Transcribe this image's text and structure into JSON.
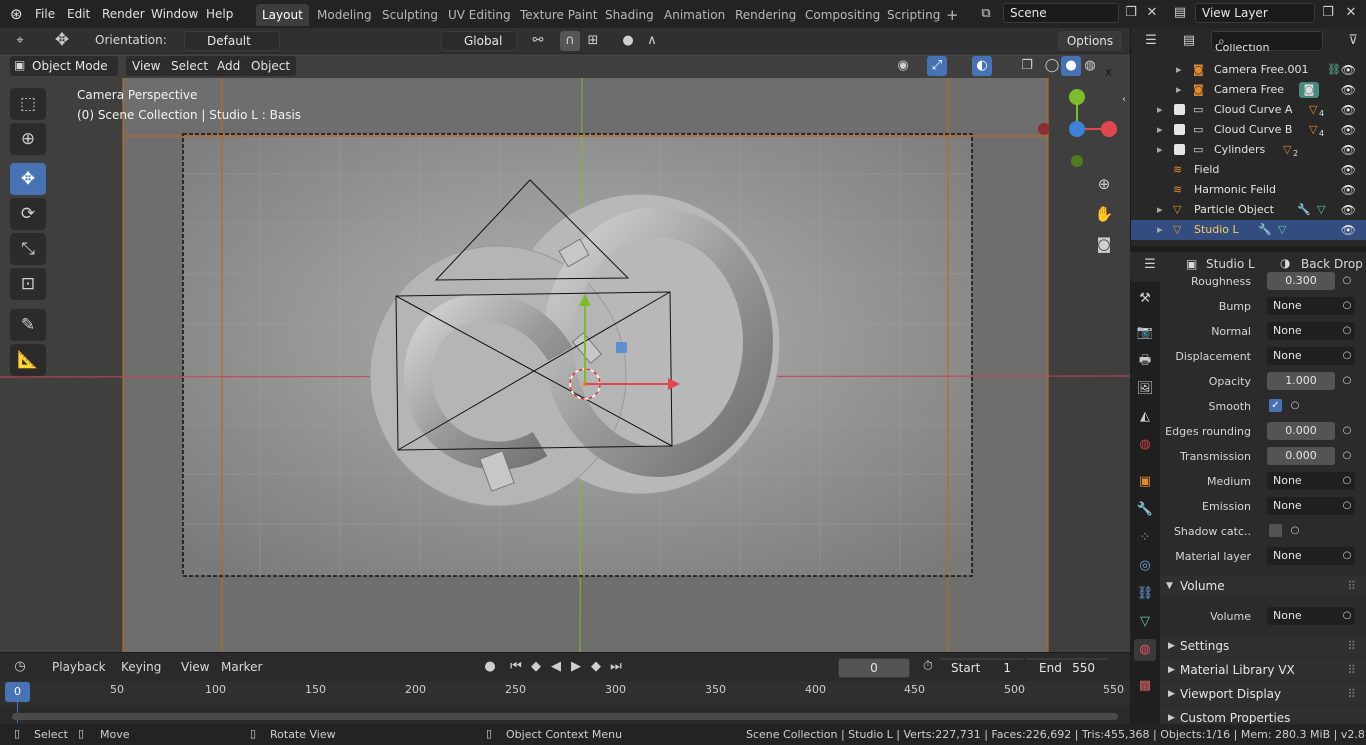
{
  "menu": [
    "File",
    "Edit",
    "Render",
    "Window",
    "Help"
  ],
  "workspaces": [
    "Layout",
    "Modeling",
    "Sculpting",
    "UV Editing",
    "Texture Paint",
    "Shading",
    "Animation",
    "Rendering",
    "Compositing",
    "Scripting"
  ],
  "active_workspace": "Layout",
  "add_workspace": "+",
  "scene": "Scene",
  "view_layer": "View Layer",
  "toolsettings": {
    "orientation_label": "Orientation:",
    "orientation_value": "Default",
    "transform_orientation": "Global",
    "options": "Options"
  },
  "viewport_header": {
    "mode": "Object Mode",
    "menus": [
      "View",
      "Select",
      "Add",
      "Object"
    ]
  },
  "viewport": {
    "line1": "Camera Perspective",
    "line2": "(0) Scene Collection | Studio L : Basis"
  },
  "gizmo_axes": {
    "y": "Y",
    "z": "Z",
    "x": "X"
  },
  "outliner": {
    "search_placeholder": "",
    "rows": [
      {
        "name": "Collection",
        "type": "collection"
      },
      {
        "name": "Camera Free.001",
        "type": "camera"
      },
      {
        "name": "Camera Free",
        "type": "camera"
      },
      {
        "name": "Cloud Curve A",
        "type": "collection",
        "badge": "4"
      },
      {
        "name": "Cloud Curve B",
        "type": "collection",
        "badge": "4"
      },
      {
        "name": "Cylinders",
        "type": "collection",
        "badge": "2"
      },
      {
        "name": "Field",
        "type": "force"
      },
      {
        "name": "Harmonic Feild",
        "type": "force"
      },
      {
        "name": "Particle Object",
        "type": "mesh"
      },
      {
        "name": "Studio L",
        "type": "mesh",
        "selected": true
      }
    ]
  },
  "properties": {
    "object": "Studio L",
    "material": "Back Drop",
    "rows": [
      {
        "label": "Roughness",
        "value": "0.300",
        "kind": "num"
      },
      {
        "label": "Bump",
        "value": "None",
        "kind": "none"
      },
      {
        "label": "Normal",
        "value": "None",
        "kind": "none"
      },
      {
        "label": "Displacement",
        "value": "None",
        "kind": "none"
      },
      {
        "label": "Opacity",
        "value": "1.000",
        "kind": "num"
      },
      {
        "label": "Smooth",
        "value": "",
        "kind": "check_on"
      },
      {
        "label": "Edges rounding",
        "value": "0.000",
        "kind": "num"
      },
      {
        "label": "Transmission",
        "value": "0.000",
        "kind": "num"
      },
      {
        "label": "Medium",
        "value": "None",
        "kind": "none"
      },
      {
        "label": "Emission",
        "value": "None",
        "kind": "none"
      },
      {
        "label": "Shadow catc..",
        "value": "",
        "kind": "check_off"
      },
      {
        "label": "Material layer",
        "value": "None",
        "kind": "none"
      }
    ],
    "volume_panel": "Volume",
    "volume_label": "Volume",
    "volume_value": "None",
    "collapsed_panels": [
      "Settings",
      "Material Library VX",
      "Viewport Display",
      "Custom Properties"
    ]
  },
  "timeline": {
    "menus": [
      "Playback",
      "Keying",
      "View",
      "Marker"
    ],
    "current_frame": "0",
    "start_label": "Start",
    "start": "1",
    "end_label": "End",
    "end": "550",
    "ruler": [
      "0",
      "50",
      "100",
      "150",
      "200",
      "250",
      "300",
      "350",
      "400",
      "450",
      "500",
      "550"
    ]
  },
  "statusbar": {
    "select": "Select",
    "move": "Move",
    "rotate": "Rotate View",
    "context": "Object Context Menu",
    "stats": "Scene Collection | Studio L | Verts:227,731 | Faces:226,692 | Tris:455,368 | Objects:1/16 | Mem: 280.3 MiB | v2.81.16"
  },
  "colors": {
    "accent": "#4772b3",
    "selected_text": "#ffca56",
    "x_axis": "#e0474f",
    "y_axis": "#7bbd2a",
    "z_axis": "#3d82d6",
    "object_orange": "#e08a32"
  }
}
